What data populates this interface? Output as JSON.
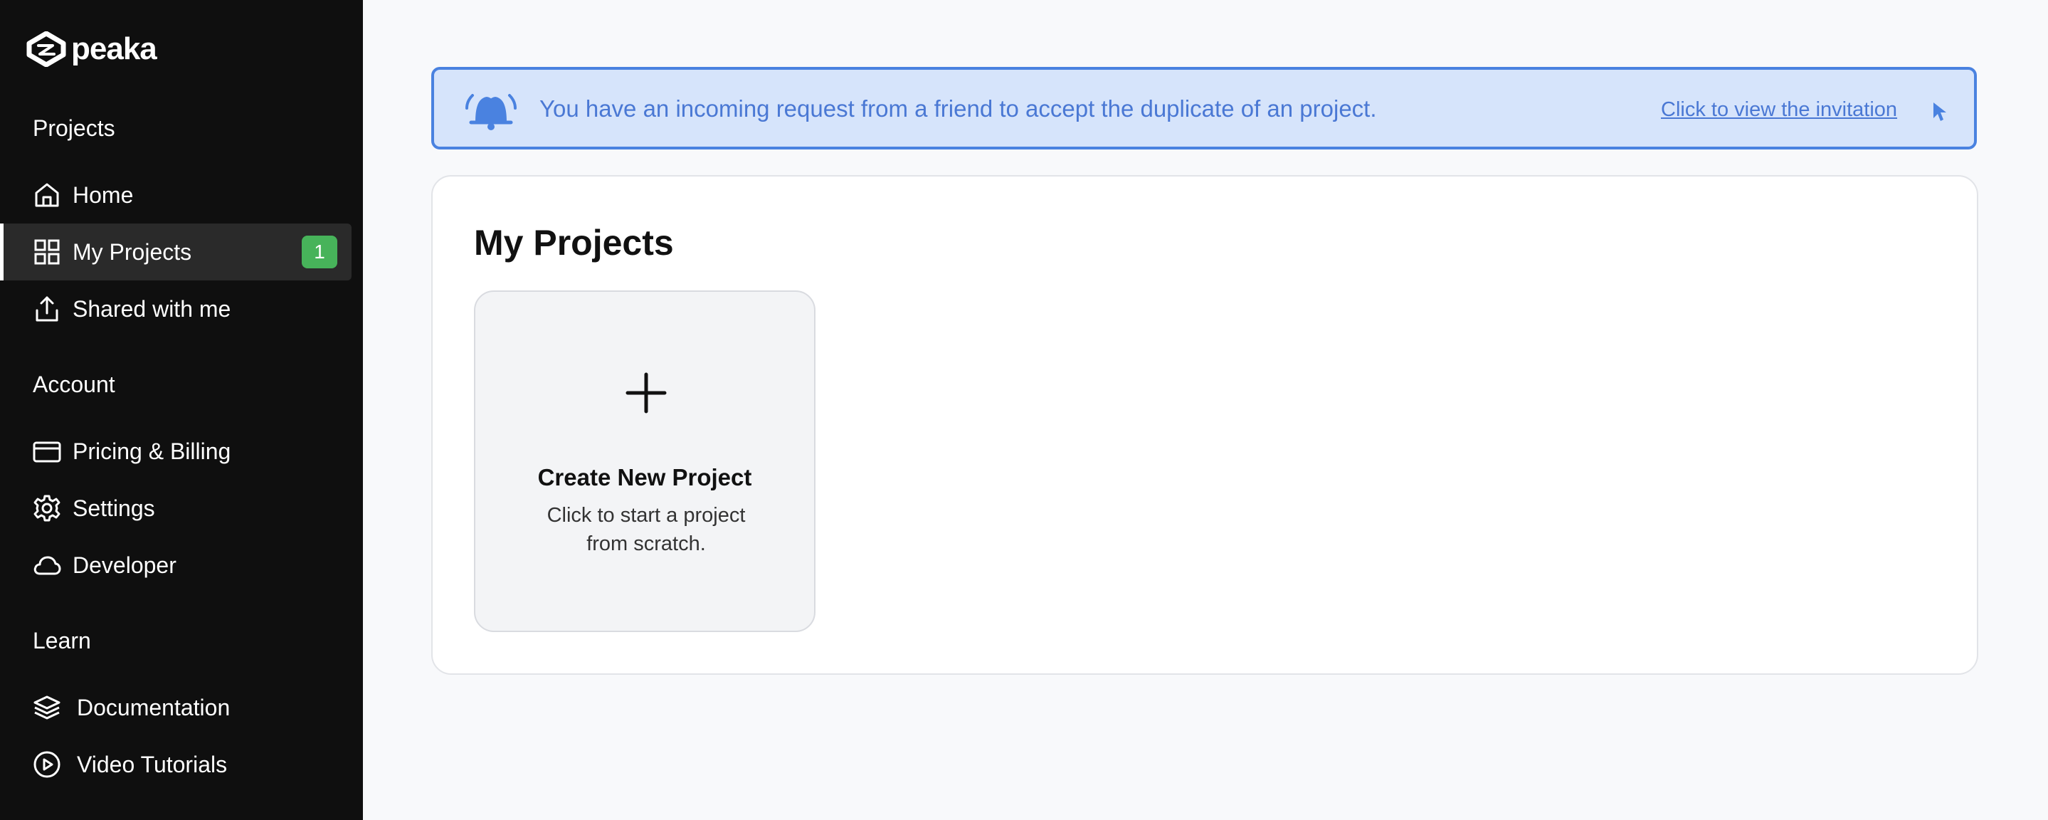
{
  "app": {
    "logo_text": "peaka"
  },
  "sidebar": {
    "sections": [
      {
        "title": "Projects"
      },
      {
        "title": "Account"
      },
      {
        "title": "Learn"
      }
    ],
    "items": [
      {
        "label": "Home",
        "icon": "home-icon"
      },
      {
        "label": "My Projects",
        "icon": "grid-icon",
        "active": true,
        "badge": "1"
      },
      {
        "label": "Shared with me",
        "icon": "share-icon"
      },
      {
        "label": "Pricing & Billing",
        "icon": "credit-card-icon"
      },
      {
        "label": "Settings",
        "icon": "gear-icon"
      },
      {
        "label": "Developer",
        "icon": "cloud-icon"
      },
      {
        "label": "Documentation",
        "icon": "layers-icon"
      },
      {
        "label": "Video Tutorials",
        "icon": "play-circle-icon"
      }
    ]
  },
  "banner": {
    "message": "You have an incoming request from a friend to accept the duplicate of an project.",
    "link_label": "Click to view the invitation",
    "icon": "bell-icon"
  },
  "main": {
    "title": "My Projects",
    "create_card": {
      "title": "Create New Project",
      "description": "Click to start a project from scratch.",
      "icon": "plus-icon"
    }
  },
  "colors": {
    "sidebar_bg": "#0f0f0f",
    "accent_blue": "#4a82e0",
    "banner_bg": "#d6e4fb",
    "badge_green": "#47b35a"
  }
}
